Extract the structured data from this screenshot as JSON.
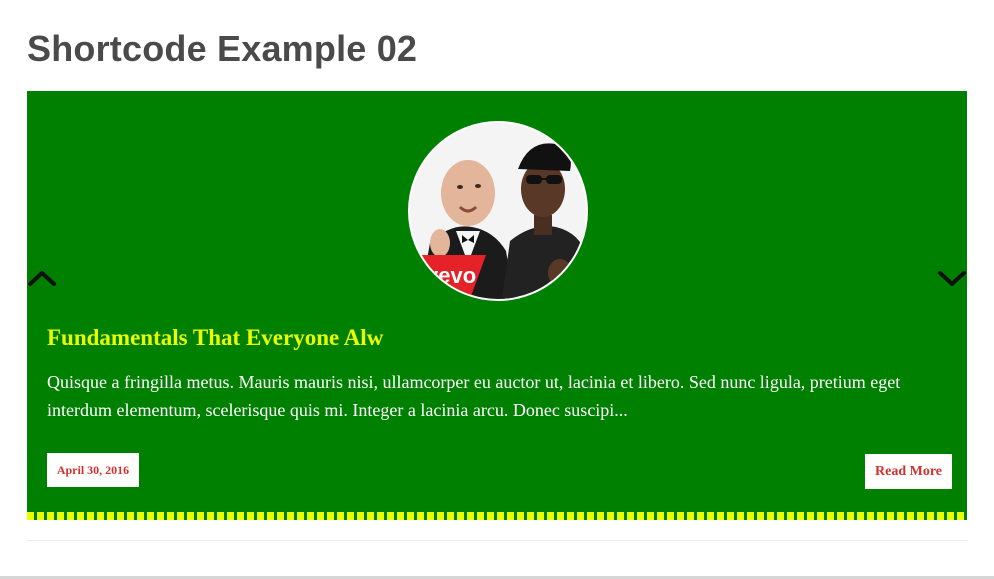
{
  "page": {
    "title": "Shortcode Example 02"
  },
  "slide": {
    "title": "Fundamentals That Everyone Alw",
    "excerpt": "Quisque a fringilla metus. Mauris mauris nisi, ullamcorper eu auctor ut, lacinia et libero. Sed nunc ligula, pretium eget interdum elementum, scelerisque quis mi. Integer a lacinia arcu. Donec suscipi...",
    "date": "April 30, 2016",
    "read_more_label": "Read More",
    "thumbnail_logo_text": "vevo"
  },
  "navigation": {
    "prev_icon": "chevron-up-icon",
    "next_icon": "chevron-down-icon"
  },
  "colors": {
    "slide_background": "#008000",
    "title_accent": "#eaff00",
    "stripe": "#eaff00",
    "badge_text": "#d0312d",
    "page_title": "#4a4a4a"
  }
}
